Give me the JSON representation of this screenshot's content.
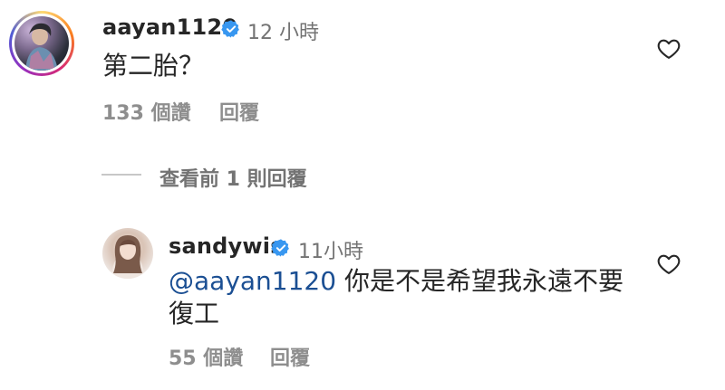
{
  "comment1": {
    "username": "aayan1120",
    "time": "12 小時",
    "text": "第二胎？",
    "likes": "133 個讚",
    "reply_label": "回覆"
  },
  "view_replies": "查看前 1 則回覆",
  "comment2": {
    "username": "sandywis",
    "time": "11小時",
    "mention": "@aayan1120",
    "text_line1": " 你是不是希望我永遠不要",
    "text_line2": "復工",
    "likes": "55 個讚",
    "reply_label": "回覆"
  },
  "colors": {
    "verified": "#3897f0",
    "mention": "#1b4f93",
    "text": "#262626",
    "meta": "#8e8e8e"
  },
  "icons": [
    "verified-badge-icon",
    "heart-icon"
  ]
}
